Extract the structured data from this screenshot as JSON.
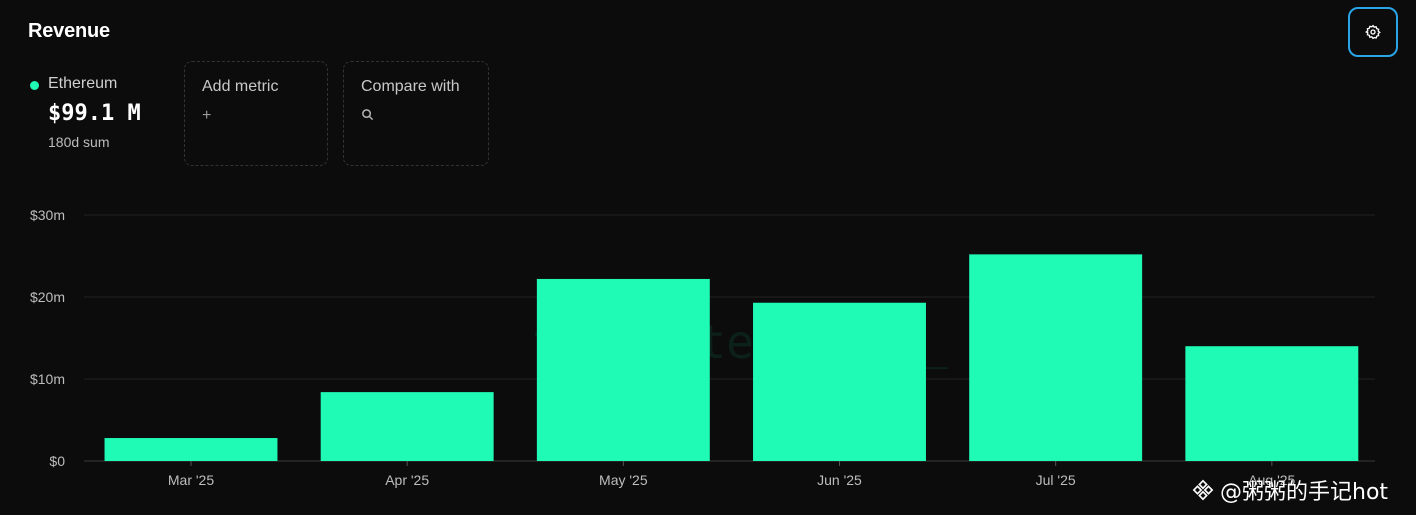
{
  "header": {
    "title": "Revenue",
    "settings_icon": "gear-icon"
  },
  "metric": {
    "name": "Ethereum",
    "value": "$99.1 M",
    "sub": "180d sum",
    "color": "#1ffab5"
  },
  "cards": {
    "add": {
      "label": "Add metric",
      "icon": "+"
    },
    "compare": {
      "label": "Compare with",
      "icon": "search-icon"
    }
  },
  "chart_data": {
    "type": "bar",
    "categories": [
      "Mar '25",
      "Apr '25",
      "May '25",
      "Jun '25",
      "Jul '25",
      "Aug '25"
    ],
    "series": [
      {
        "name": "Ethereum",
        "values": [
          2.8,
          8.4,
          22.2,
          19.3,
          25.2,
          14.0
        ]
      }
    ],
    "ylim": [
      0,
      30
    ],
    "yticks": [
      0,
      10,
      20,
      30
    ],
    "ytick_labels": [
      "$0",
      "$10m",
      "$20m",
      "$30m"
    ],
    "grid": true,
    "bar_color": "#1ffab5",
    "watermark": "token terminal_"
  },
  "overlay": {
    "watermark_text": "@粥粥的手记hot"
  }
}
